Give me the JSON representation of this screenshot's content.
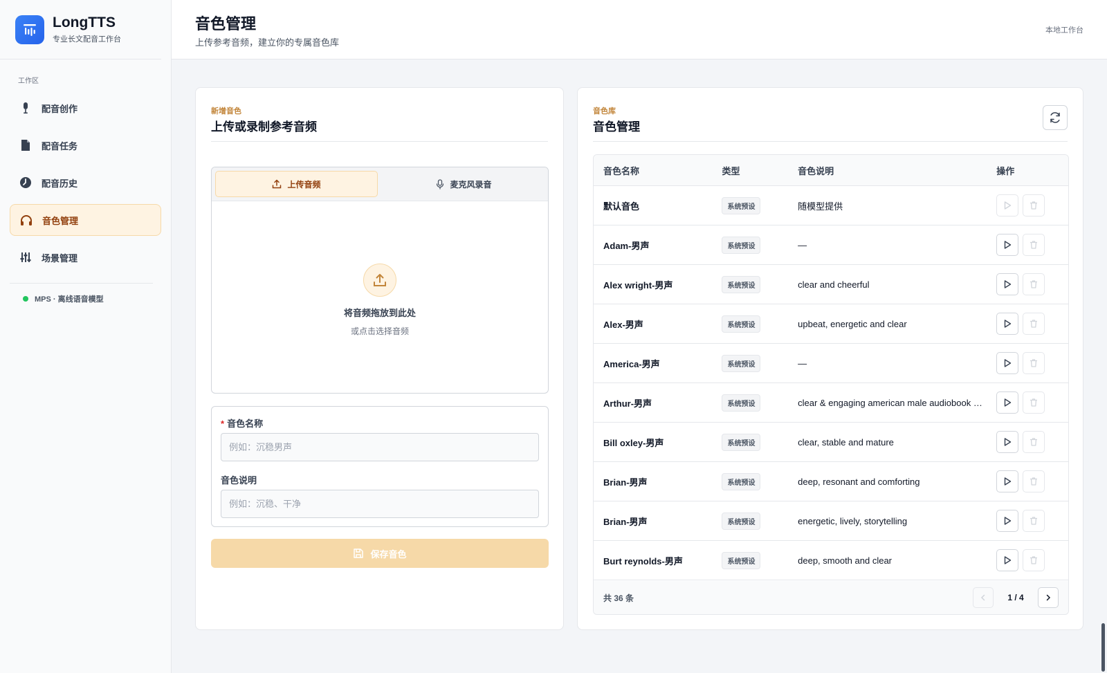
{
  "brand": {
    "title": "LongTTS",
    "subtitle": "专业长文配音工作台",
    "accent": "#2563eb"
  },
  "sidebar": {
    "section_label": "工作区",
    "items": [
      {
        "label": "配音创作",
        "icon": "microphone-icon",
        "active": false
      },
      {
        "label": "配音任务",
        "icon": "document-icon",
        "active": false
      },
      {
        "label": "配音历史",
        "icon": "clock-icon",
        "active": false
      },
      {
        "label": "音色管理",
        "icon": "headphones-icon",
        "active": true
      },
      {
        "label": "场景管理",
        "icon": "sliders-icon",
        "active": false
      }
    ],
    "model_status": "MPS · 离线语音模型",
    "status_color": "#22c55e"
  },
  "header": {
    "title": "音色管理",
    "subtitle": "上传参考音频，建立你的专属音色库",
    "workspace": "本地工作台"
  },
  "new_voice": {
    "eyebrow": "新增音色",
    "title": "上传或录制参考音频",
    "tabs": [
      {
        "label": "上传音频",
        "icon": "upload-icon",
        "active": true
      },
      {
        "label": "麦克风录音",
        "icon": "microphone-icon",
        "active": false
      }
    ],
    "drop_title": "将音频拖放到此处",
    "drop_subtitle": "或点击选择音频",
    "name_label": "音色名称",
    "name_required_mark": "*",
    "name_placeholder": "例如：沉稳男声",
    "name_value": "",
    "desc_label": "音色说明",
    "desc_placeholder": "例如：沉稳、干净",
    "desc_value": "",
    "save_label": "保存音色",
    "accent": "#c2853a"
  },
  "voice_library": {
    "eyebrow": "音色库",
    "title": "音色管理",
    "columns": [
      "音色名称",
      "类型",
      "音色说明",
      "操作"
    ],
    "rows": [
      {
        "name": "默认音色",
        "type": "系统预设",
        "desc": "随模型提供",
        "play_enabled": false
      },
      {
        "name": "Adam-男声",
        "type": "系统预设",
        "desc": "—",
        "play_enabled": true
      },
      {
        "name": "Alex wright-男声",
        "type": "系统预设",
        "desc": "clear and cheerful",
        "play_enabled": true
      },
      {
        "name": "Alex-男声",
        "type": "系统预设",
        "desc": "upbeat, energetic and clear",
        "play_enabled": true
      },
      {
        "name": "America-男声",
        "type": "系统预设",
        "desc": "—",
        "play_enabled": true
      },
      {
        "name": "Arthur-男声",
        "type": "系统预设",
        "desc": "clear & engaging american male audiobook narrator",
        "play_enabled": true
      },
      {
        "name": "Bill oxley-男声",
        "type": "系统预设",
        "desc": "clear, stable and mature",
        "play_enabled": true
      },
      {
        "name": "Brian-男声",
        "type": "系统预设",
        "desc": "deep, resonant and comforting",
        "play_enabled": true
      },
      {
        "name": "Brian-男声",
        "type": "系统预设",
        "desc": "energetic, lively, storytelling",
        "play_enabled": true
      },
      {
        "name": "Burt reynolds-男声",
        "type": "系统预设",
        "desc": "deep, smooth and clear",
        "play_enabled": true
      }
    ],
    "total_text": "共 36 条",
    "page_indicator": "1 / 4"
  }
}
